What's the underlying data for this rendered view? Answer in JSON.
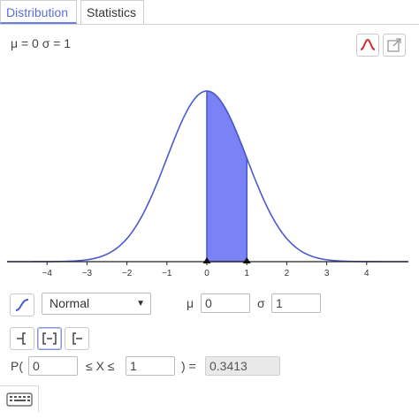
{
  "tabs": [
    {
      "label": "Distribution"
    },
    {
      "label": "Statistics"
    }
  ],
  "params_text": "μ = 0  σ = 1",
  "header_icons": [
    "normal-curve-icon",
    "export-icon"
  ],
  "colors": {
    "accent": "#5a6fd6",
    "curve": "#4a5bd0",
    "fill": "#7b82f5",
    "icon_red": "#d03030"
  },
  "chart_data": {
    "type": "area",
    "distribution": "Normal",
    "mean": 0,
    "sd": 1,
    "xlim": [
      -5,
      5
    ],
    "x_ticks": [
      "−4",
      "−3",
      "−2",
      "−1",
      "0",
      "1",
      "2",
      "3",
      "4"
    ],
    "shaded_interval": [
      0,
      1
    ],
    "markers": [
      0,
      1
    ]
  },
  "controls": {
    "distribution_select": "Normal",
    "mu_label": "μ",
    "mu_value": "0",
    "sigma_label": "σ",
    "sigma_value": "1",
    "p_prefix": "P(",
    "lower_value": "0",
    "middle_text": "≤ X ≤",
    "upper_value": "1",
    "equals_text": ") =",
    "result_value": "0.3413"
  }
}
